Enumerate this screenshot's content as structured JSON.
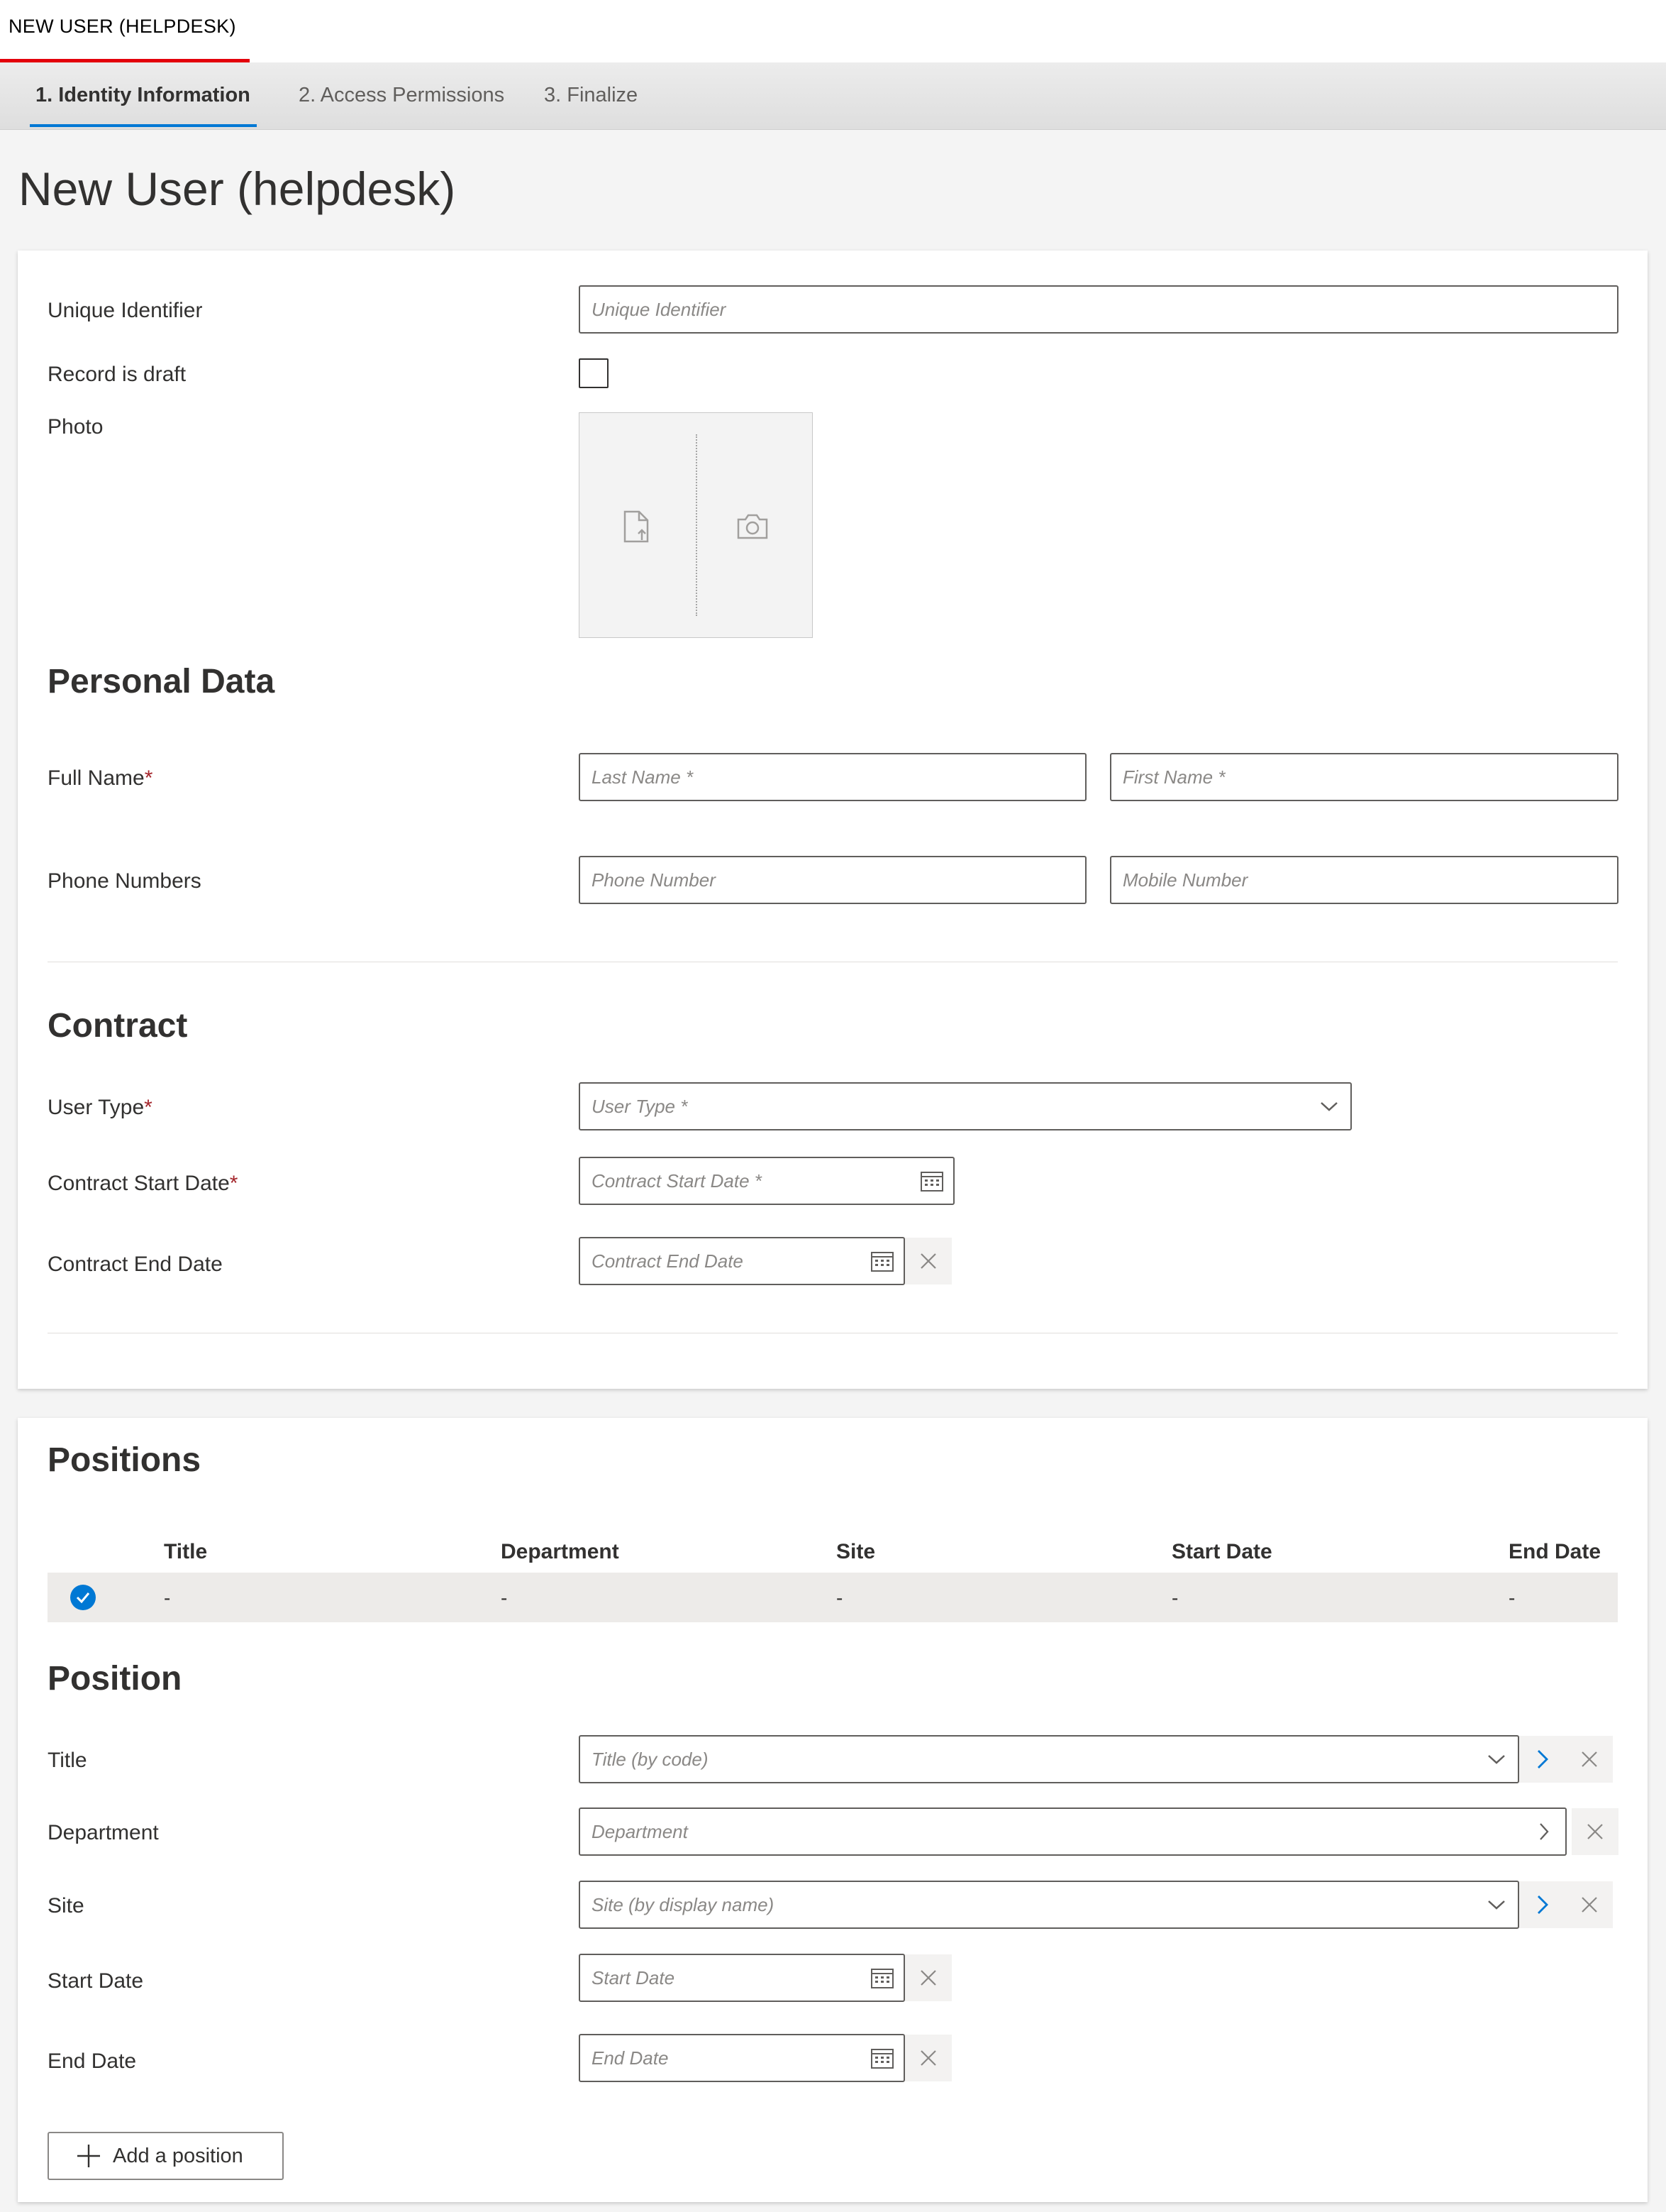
{
  "app_tab": {
    "label": "NEW USER (HELPDESK)"
  },
  "steps": [
    {
      "label": "1. Identity Information"
    },
    {
      "label": "2. Access Permissions"
    },
    {
      "label": "3. Finalize"
    }
  ],
  "page_title": "New User (helpdesk)",
  "identity": {
    "unique_identifier": {
      "label": "Unique Identifier",
      "placeholder": "Unique Identifier"
    },
    "record_is_draft": {
      "label": "Record is draft",
      "checked": false
    },
    "photo": {
      "label": "Photo",
      "upload_icon": "file-upload-icon",
      "camera_icon": "camera-icon"
    }
  },
  "personal_data": {
    "heading": "Personal Data",
    "full_name": {
      "label": "Full Name",
      "required_mark": "*",
      "last_placeholder": "Last Name *",
      "first_placeholder": "First Name *"
    },
    "phone_numbers": {
      "label": "Phone Numbers",
      "phone_placeholder": "Phone Number",
      "mobile_placeholder": "Mobile Number"
    }
  },
  "contract": {
    "heading": "Contract",
    "user_type": {
      "label": "User Type",
      "required_mark": "*",
      "placeholder": "User Type *"
    },
    "start_date": {
      "label": "Contract Start Date",
      "required_mark": "*",
      "placeholder": "Contract Start Date *"
    },
    "end_date": {
      "label": "Contract End Date",
      "placeholder": "Contract End Date"
    }
  },
  "positions": {
    "heading": "Positions",
    "columns": [
      "Title",
      "Department",
      "Site",
      "Start Date",
      "End Date"
    ],
    "rows": [
      {
        "selected": true,
        "cells": [
          "-",
          "-",
          "-",
          "-",
          "-"
        ]
      }
    ]
  },
  "position": {
    "heading": "Position",
    "title": {
      "label": "Title",
      "placeholder": "Title (by code)"
    },
    "department": {
      "label": "Department",
      "placeholder": "Department"
    },
    "site": {
      "label": "Site",
      "placeholder": "Site (by display name)"
    },
    "start_date": {
      "label": "Start Date",
      "placeholder": "Start Date"
    },
    "end_date": {
      "label": "End Date",
      "placeholder": "End Date"
    }
  },
  "add_position_label": "Add a position",
  "colors": {
    "accent": "#0078d4",
    "brand_red": "#e3000b",
    "required": "#a4262c"
  }
}
